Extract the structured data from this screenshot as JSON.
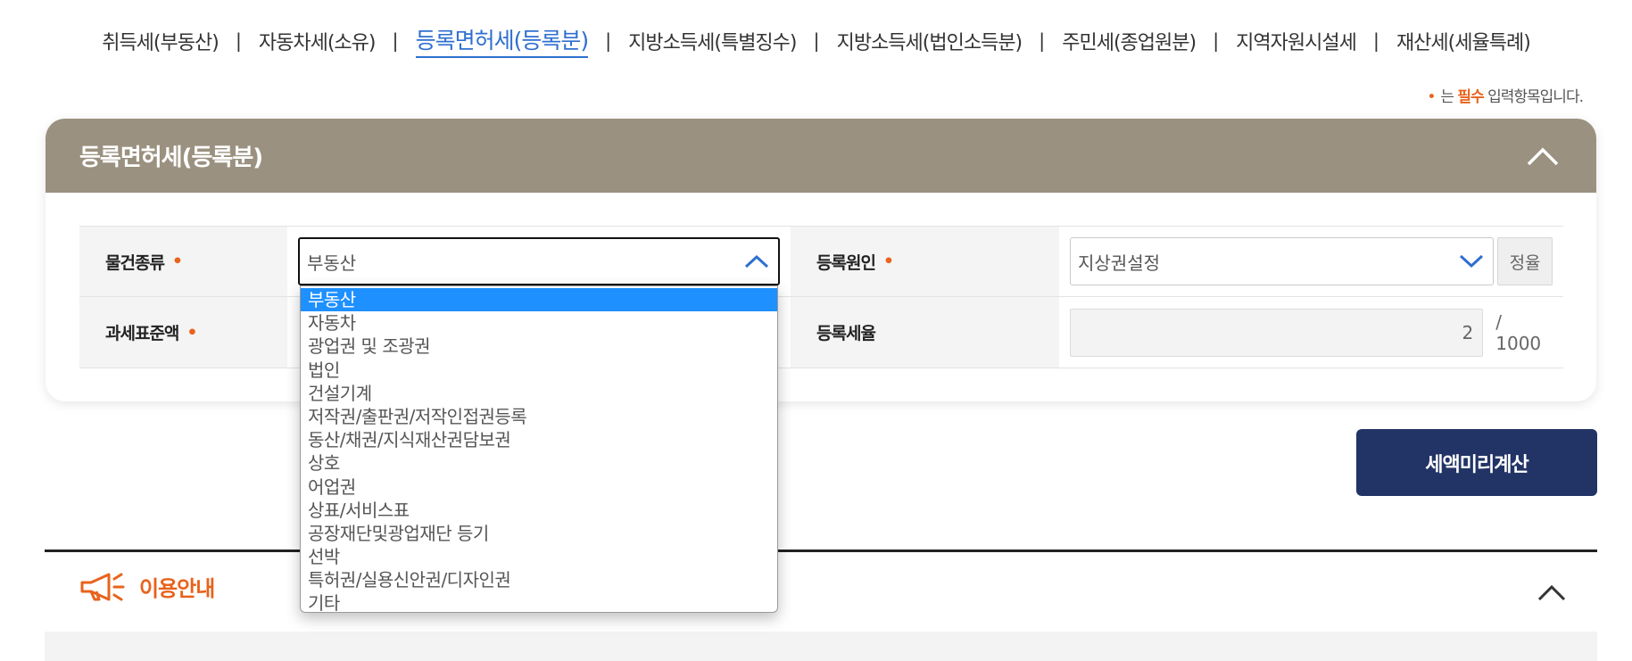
{
  "tabs": [
    {
      "label": "취득세(부동산)",
      "active": false
    },
    {
      "label": "자동차세(소유)",
      "active": false
    },
    {
      "label": "등록면허세(등록분)",
      "active": true
    },
    {
      "label": "지방소득세(특별징수)",
      "active": false
    },
    {
      "label": "지방소득세(법인소득분)",
      "active": false
    },
    {
      "label": "주민세(종업원분)",
      "active": false
    },
    {
      "label": "지역자원시설세",
      "active": false
    },
    {
      "label": "재산세(세율특례)",
      "active": false
    }
  ],
  "separator": "|",
  "required_note": {
    "dot": "•",
    "prefix": "는 ",
    "emphasis": "필수",
    "suffix": " 입력항목입니다."
  },
  "card": {
    "title": "등록면허세(등록분)"
  },
  "form": {
    "item_type": {
      "label": "물건종류",
      "required_mark": "•",
      "value": "부동산"
    },
    "reg_cause": {
      "label": "등록원인",
      "required_mark": "•",
      "value": "지상권설정",
      "sort_button": "정율"
    },
    "tax_base": {
      "label": "과세표준액",
      "required_mark": "•"
    },
    "reg_rate": {
      "label": "등록세율",
      "value": "2",
      "unit": "/ 1000"
    }
  },
  "dropdown_options": [
    "부동산",
    "자동차",
    "광업권 및 조광권",
    "법인",
    "건설기계",
    "저작권/출판권/저작인접권등록",
    "동산/채권/지식재산권담보권",
    "상호",
    "어업권",
    "상표/서비스표",
    "공장재단및광업재단 등기",
    "선박",
    "특허권/실용신안권/디자인권",
    "기타"
  ],
  "selected_option_index": 0,
  "calc_button": "세액미리계산",
  "guide": {
    "title": "이용안내",
    "icon": "megaphone-icon"
  },
  "colors": {
    "accent_blue": "#2e6fcf",
    "header_brown": "#9b9180",
    "required_orange": "#e8631c",
    "button_navy": "#223466",
    "option_highlight": "#1e90ff"
  }
}
